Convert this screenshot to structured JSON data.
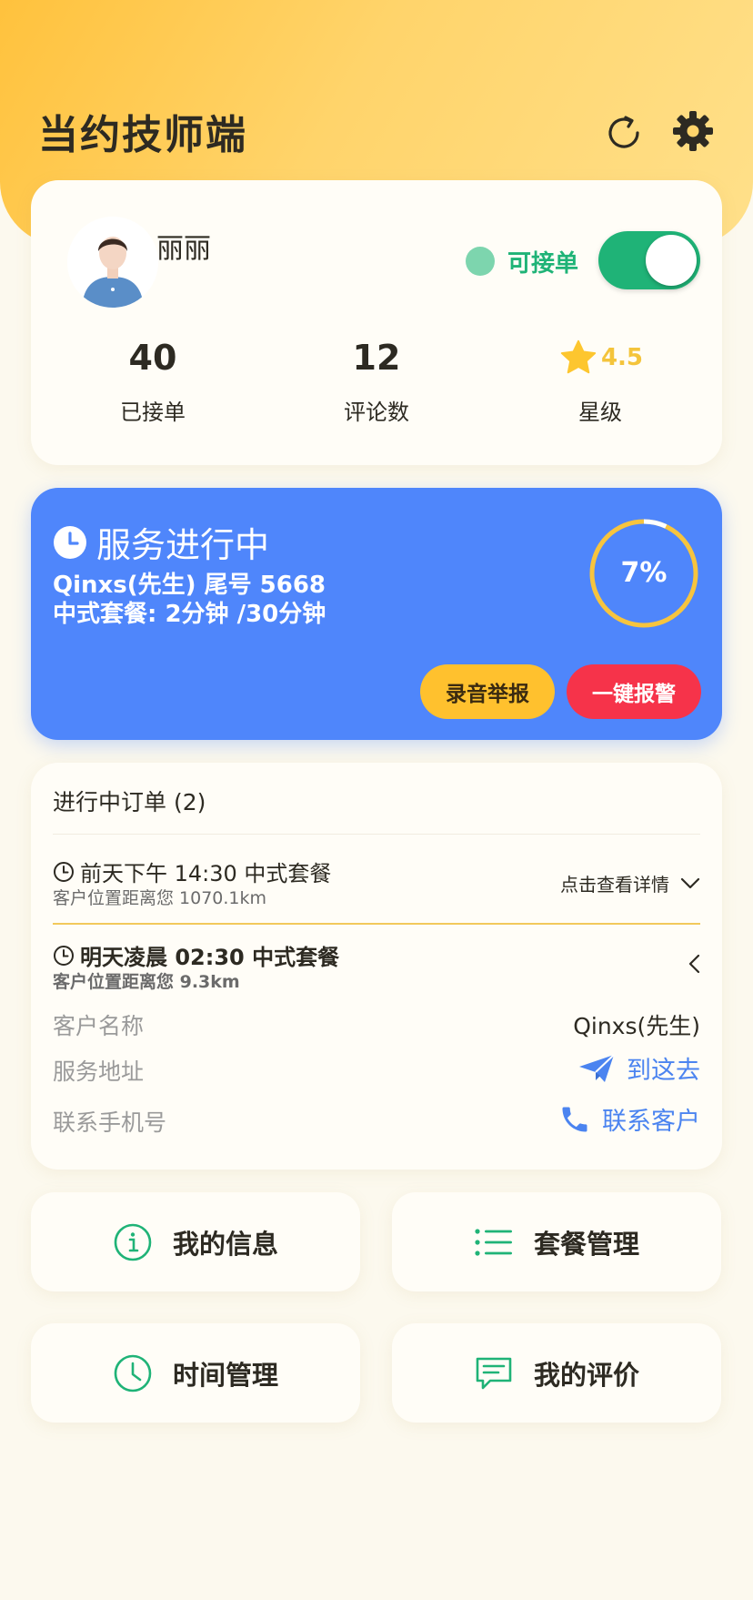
{
  "header": {
    "app_title": "当约技师端",
    "refresh_icon": "refresh-icon",
    "settings_icon": "gear-icon"
  },
  "profile": {
    "name": "丽丽",
    "status_label": "可接单",
    "accepting_orders": true,
    "stats": {
      "orders_value": "40",
      "orders_label": "已接单",
      "reviews_value": "12",
      "reviews_label": "评论数",
      "rating_value": "4.5",
      "rating_label": "星级"
    }
  },
  "service": {
    "title": "服务进行中",
    "customer_line": "Qinxs(先生) 尾号 5668",
    "package_line": "中式套餐: 2分钟 /30分钟",
    "progress_text": "7%",
    "progress_fraction": 0.07,
    "record_report_label": "录音举报",
    "alarm_label": "一键报警"
  },
  "orders": {
    "title": "进行中订单 (2)",
    "items": [
      {
        "time_text": "前天下午 14:30 中式套餐",
        "distance_text": "客户位置距离您 1070.1km",
        "detail_label": "点击查看详情"
      },
      {
        "time_text": "明天凌晨 02:30 中式套餐",
        "distance_text": "客户位置距离您 9.3km",
        "customer_name_label": "客户名称",
        "customer_name_value": "Qinxs(先生)",
        "address_label": "服务地址",
        "navigate_label": "到这去",
        "phone_label": "联系手机号",
        "contact_label": "联系客户"
      }
    ]
  },
  "menu": {
    "my_info": "我的信息",
    "package_manage": "套餐管理",
    "time_manage": "时间管理",
    "my_reviews": "我的评价"
  },
  "colors": {
    "accent_green": "#1fb377",
    "service_blue": "#4f86fb",
    "warning_yellow": "#ffc12e",
    "alarm_red": "#f6334a",
    "link_blue": "#4b84f0"
  }
}
